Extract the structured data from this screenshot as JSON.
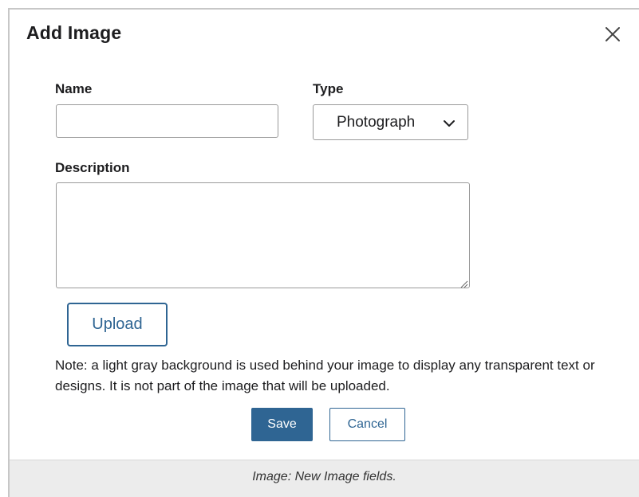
{
  "dialog": {
    "title": "Add Image",
    "close_icon": "close-icon"
  },
  "form": {
    "name": {
      "label": "Name",
      "value": "",
      "placeholder": ""
    },
    "type": {
      "label": "Type",
      "selected": "Photograph",
      "icon": "chevron-down-icon"
    },
    "description": {
      "label": "Description",
      "value": "",
      "placeholder": ""
    },
    "upload_label": "Upload",
    "note": "Note: a light gray background is used behind your image to display any transparent text or designs. It is not part of the image that will be uploaded."
  },
  "actions": {
    "save_label": "Save",
    "cancel_label": "Cancel"
  },
  "caption": "Image: New Image fields.",
  "colors": {
    "accent": "#2f6593",
    "caption_bg": "#ececec"
  }
}
